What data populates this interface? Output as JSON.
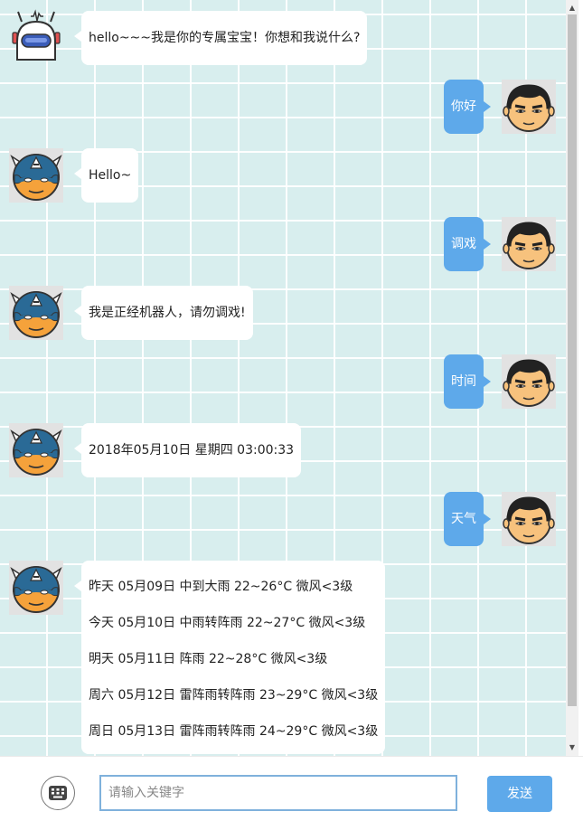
{
  "messages": {
    "m1": {
      "text": "hello~~~我是你的专属宝宝！你想和我说什么?"
    },
    "m2": {
      "text": "你好"
    },
    "m3": {
      "text": "Hello~"
    },
    "m4": {
      "text": "调戏"
    },
    "m5": {
      "text": "我是正经机器人，请勿调戏!"
    },
    "m6": {
      "text": "时间"
    },
    "m7": {
      "text": "2018年05月10日 星期四 03:00:33"
    },
    "m8": {
      "text": "天气"
    },
    "m9": {
      "lines": [
        "昨天 05月09日 中到大雨 22~26°C 微风<3级",
        "今天 05月10日 中雨转阵雨 22~27°C 微风<3级",
        "明天 05月11日 阵雨 22~28°C 微风<3级",
        "周六 05月12日 雷阵雨转阵雨 23~29°C 微风<3级",
        "周日 05月13日 雷阵雨转阵雨 24~29°C 微风<3级"
      ]
    }
  },
  "input": {
    "placeholder": "请输入关键字",
    "value": ""
  },
  "send_button": {
    "label": "发送"
  },
  "icons": {
    "keyboard": "keyboard-icon",
    "robot": "robot-avatar-icon",
    "bot_mascot": "captain-mask-avatar-icon",
    "user": "user-face-avatar-icon"
  },
  "colors": {
    "chat_background": "#d8eeee",
    "grid_line": "#ffffff",
    "user_bubble": "#5ea9ea",
    "bot_bubble": "#ffffff",
    "send_button": "#5ea9ea",
    "input_border": "#7fb1dc"
  }
}
